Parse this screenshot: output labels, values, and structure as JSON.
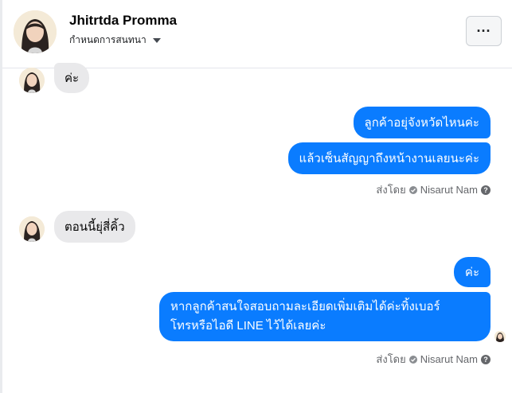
{
  "header": {
    "contact_name": "Jhitrtda Promma",
    "subtitle": "กำหนดการสนทนา",
    "more_label": "···",
    "avatar_icon": "profile-photo"
  },
  "messages": [
    {
      "direction": "incoming",
      "text": "ค่ะ"
    },
    {
      "direction": "outgoing",
      "text": "ลูกค้าอยุ่จังหวัดไหนค่ะ"
    },
    {
      "direction": "outgoing",
      "text": "แล้วเซ็นสัญญาถึงหน้างานเลยนะค่ะ"
    },
    {
      "direction": "incoming",
      "text": "ตอนนี้ยุ่สี่คิ้ว"
    },
    {
      "direction": "outgoing",
      "text": "ค่ะ"
    },
    {
      "direction": "outgoing",
      "line1": "หากลูกค้าสนใจสอบถามละเอียดเพิ่มเติมได้ค่ะทิ้งเบอร์",
      "line2": "โทรหรือไอดี LINE ไว้ได้เลยค่ะ"
    }
  ],
  "sent_by": {
    "prefix": "ส่งโดย",
    "sender": "Nisarut Nam",
    "help": "?"
  },
  "colors": {
    "outgoing_bubble": "#0a7cff",
    "incoming_bubble": "#e9e9eb",
    "meta_text": "#65676b"
  }
}
